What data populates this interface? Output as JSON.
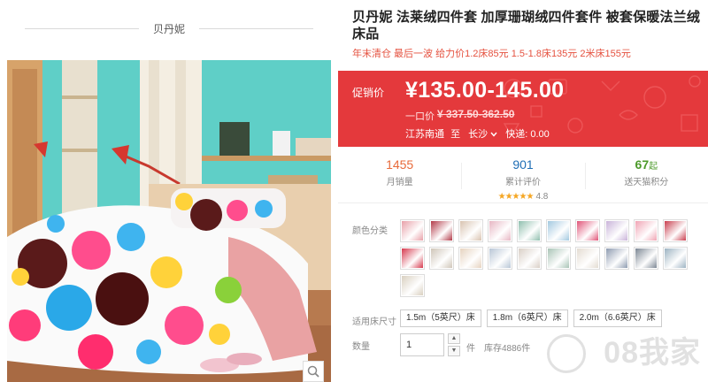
{
  "store": {
    "brand": "贝丹妮"
  },
  "product": {
    "title": "贝丹妮 法莱绒四件套 加厚珊瑚绒四件套件 被套保暖法兰绒床品",
    "subtitle": "年末清仓 最后一波 给力价1.2床85元 1.5-1.8床135元 2米床155元"
  },
  "price": {
    "label": "促销价",
    "current": "¥135.00-145.00",
    "original_label": "一口价",
    "original": "¥ 337.50-362.50",
    "origin": "江苏南通",
    "to_label": "至",
    "destination": "长沙",
    "shipping": "快递: 0.00",
    "accent_color": "#e4393c"
  },
  "stats": [
    {
      "value": "1455",
      "label": "月销量",
      "color": "#e86a3a"
    },
    {
      "value": "901",
      "label": "累计评价",
      "color": "#1e6eb5",
      "stars": "★★★★★",
      "rating": "4.8"
    },
    {
      "value": "67",
      "suffix": "起",
      "label": "送天猫积分",
      "color": "#4c9a2a"
    }
  ],
  "options": {
    "color_label": "颜色分类",
    "swatch_colors": [
      "#e8a0a8",
      "#b23a48",
      "#d9c3b0",
      "#e7b6c3",
      "#8fbfae",
      "#a3c9e0",
      "#e05578",
      "#c9b3d9",
      "#f0a4b4",
      "#c94050",
      "#d63a4e",
      "#cfc5b8",
      "#e6d3bf",
      "#b8c6d6",
      "#d9cfc6",
      "#a9c4b6",
      "#e4dcd2",
      "#8e9bb0",
      "#7c8794",
      "#9db3c2",
      "#d9d0c0"
    ],
    "size_label": "适用床尺寸",
    "sizes": [
      "1.5m（5英尺）床",
      "1.8m（6英尺）床",
      "2.0m（6.6英尺）床"
    ],
    "qty_label": "数量",
    "qty_value": "1",
    "qty_unit": "件",
    "stock": "库存4886件"
  },
  "watermark": "08我家"
}
